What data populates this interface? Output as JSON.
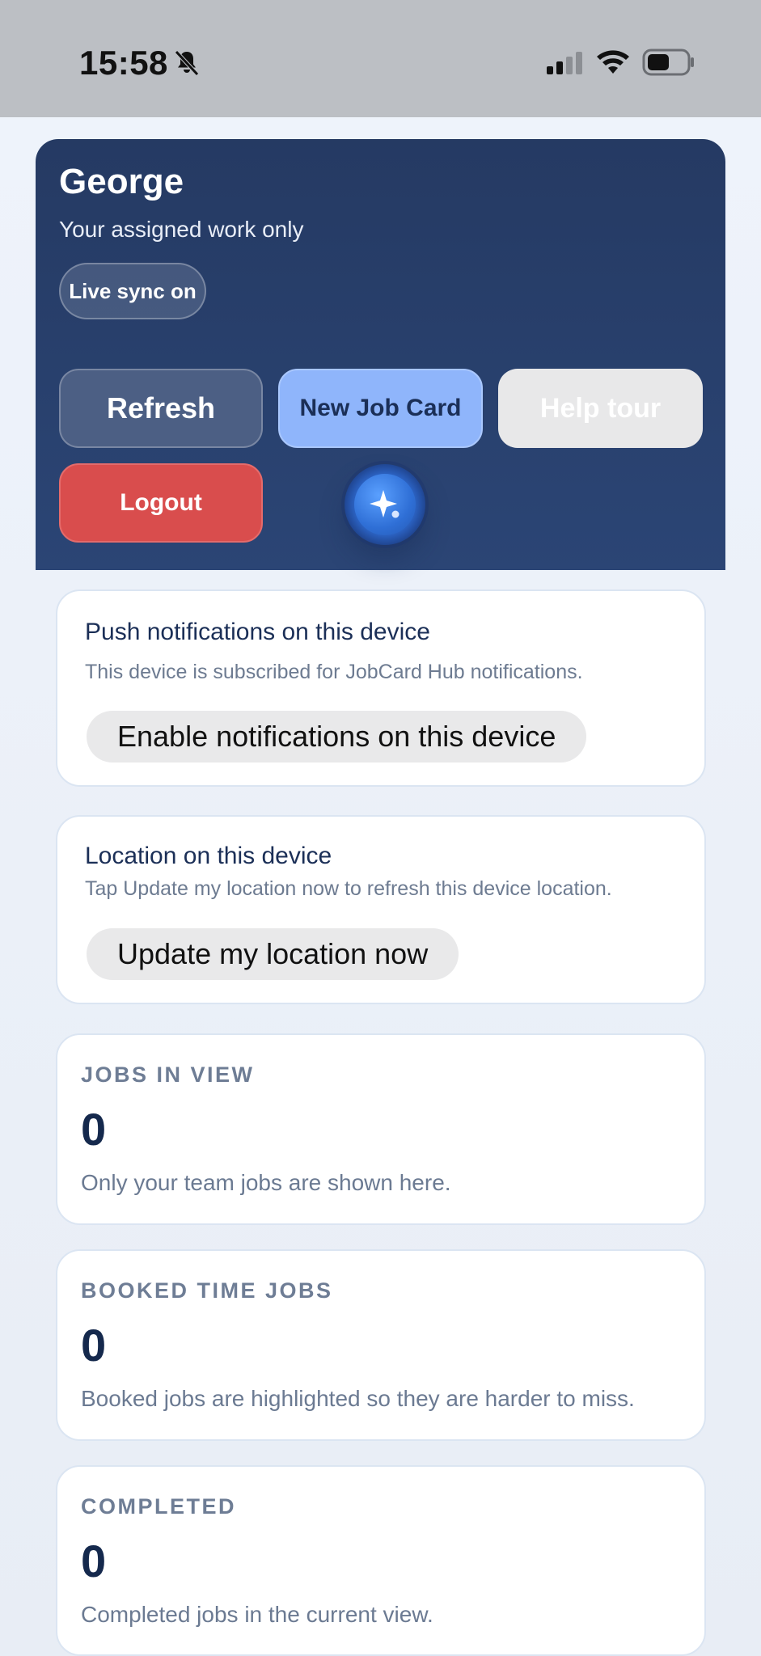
{
  "status_bar": {
    "time": "15:58",
    "icons": [
      "bell-slash-icon",
      "signal-icon",
      "wifi-icon",
      "battery-icon"
    ]
  },
  "header": {
    "title": "George",
    "subtitle": "Your assigned work only",
    "sync_badge": "Live sync on",
    "buttons": {
      "refresh": "Refresh",
      "new_job_card": "New Job Card",
      "help_tour": "Help tour",
      "logout": "Logout"
    },
    "assistant_icon": "sparkle-icon"
  },
  "push_notifications": {
    "heading": "Push notifications on this device",
    "description": "This device is subscribed for JobCard Hub notifications.",
    "button": "Enable notifications on this device"
  },
  "location": {
    "heading": "Location on this device",
    "description": "Tap Update my location now to refresh this device location.",
    "button": "Update my location now"
  },
  "stats": [
    {
      "label": "JOBS IN VIEW",
      "value": "0",
      "description": "Only your team jobs are shown here."
    },
    {
      "label": "BOOKED TIME JOBS",
      "value": "0",
      "description": "Booked jobs are highlighted so they are harder to miss."
    },
    {
      "label": "COMPLETED",
      "value": "0",
      "description": "Completed jobs in the current view."
    }
  ],
  "colors": {
    "header_bg": "#253a63",
    "accent_blue": "#8fb5fb",
    "logout_red": "#d94d4d",
    "text_dark": "#15294d"
  }
}
